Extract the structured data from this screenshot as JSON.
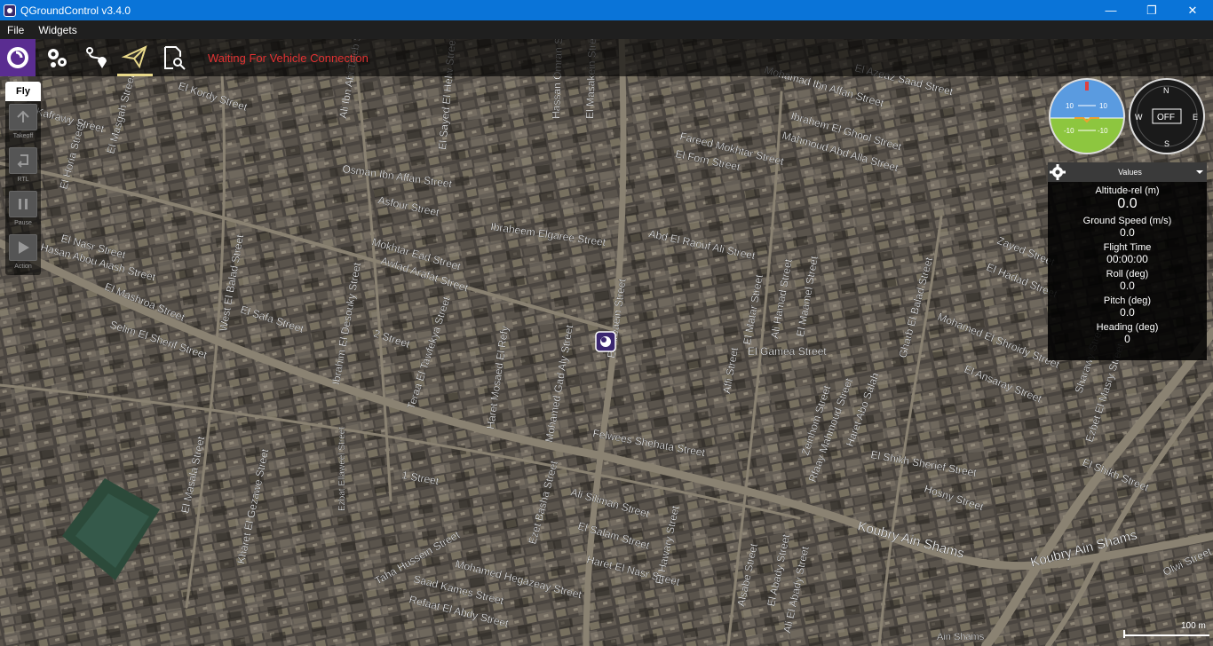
{
  "window": {
    "title": "QGroundControl v3.4.0",
    "minimize": "—",
    "restore": "❐",
    "close": "✕"
  },
  "menu": {
    "items": [
      "File",
      "Widgets"
    ]
  },
  "toolbar": {
    "status": "Waiting For Vehicle Connection",
    "buttons": [
      "qgc-logo-icon",
      "settings-gears-icon",
      "plan-route-icon",
      "fly-paper-plane-icon",
      "analyze-document-icon"
    ],
    "accent": "#e9d98a",
    "status_color": "#e23232"
  },
  "fly_panel": {
    "title": "Fly",
    "buttons": [
      {
        "label": "Takeoff",
        "icon": "takeoff-icon"
      },
      {
        "label": "RTL",
        "icon": "rtl-icon"
      },
      {
        "label": "Pause",
        "icon": "pause-icon"
      },
      {
        "label": "Action",
        "icon": "action-play-icon"
      }
    ]
  },
  "instruments": {
    "attitude": {
      "ticks": [
        "10",
        "10",
        "-10",
        "-10"
      ]
    },
    "compass": {
      "letters": {
        "n": "N",
        "e": "E",
        "s": "S",
        "w": "W"
      },
      "status": "OFF"
    }
  },
  "values_panel": {
    "title": "Values",
    "rows": [
      {
        "label": "Altitude-rel (m)",
        "value": "0.0"
      },
      {
        "label": "Ground Speed (m/s)",
        "value": "0.0"
      },
      {
        "label": "Flight Time",
        "value": "00:00:00"
      },
      {
        "label": "Roll (deg)",
        "value": "0.0"
      },
      {
        "label": "Pitch (deg)",
        "value": "0.0"
      },
      {
        "label": "Heading (deg)",
        "value": "0"
      }
    ]
  },
  "map": {
    "streets": [
      "El Kordy Street",
      "Mohamad Ibn Affan Street",
      "El Azeaz Saad Street",
      "Ibrahem El Ghool Street",
      "Mahmoud Abd Alla Street",
      "Fareed Mokhtar Street",
      "El Forn Street",
      "Osman Ibn Affan Street",
      "Asfour Street",
      "Ibraheem Elgaree Street",
      "Abd El Raouf Ali Street",
      "Mokhtar Ead Street",
      "Awlad Arafat Street",
      "El Nasr Street",
      "Hasan Abou Aiash Street",
      "El Mashroa Street",
      "El Safa Street",
      "Selim El Sherif Street",
      "2 Street",
      "El Gamea Street",
      "Felwees Shehata Street",
      "El Shikh Sherief Street",
      "El Shikh Street",
      "Hosny Street",
      "1 Street",
      "Ali Siliman Street",
      "El Salam Street",
      "Haret El Nasr Street",
      "Taha Hussein Street",
      "Mohamed Hegazeay Street",
      "Saad Kames Street",
      "Refaat El Abdy Street",
      "Koubry Ain Shams",
      "Zayed Street",
      "El Hadad Street",
      "Mohamed El Shroidy Street",
      "El Ansaray Street",
      "Ain Shams",
      "Olwi Street",
      "El Arbaein Street",
      "Mohamed Gad Aly Street",
      "Haret Mosaed El Refy",
      "Teraa El Tawfekya Street",
      "West El Balad Street",
      "Ibrahim El Desouky Street",
      "Affi Street",
      "El Matar Street",
      "Ali Hamad Street",
      "El Maamel Street",
      "Gharb El Balad Street",
      "El Masala Street",
      "Kharet El Gezawe Street",
      "Ezbat Ellaweel Street",
      "Ezbet El Masry Street",
      "Rfaay Mahmoud Street",
      "Zeinhom Street",
      "Haret Abo Salah",
      "Alsabe Street",
      "El Abady Street",
      "Ali El Abady Street",
      "Ezet Basha Street",
      "El Hawary Street",
      "Sharawy Street",
      "El Sayed El Helw Street",
      "Hassan Omran Street",
      "El Masakein Street",
      "Ali Ibn Abi Taleb Street",
      "El Masgah Street",
      "El Horia Street",
      "Kafrawy Street"
    ],
    "scale_label": "100 m",
    "marker": "vehicle-home-marker-icon"
  }
}
